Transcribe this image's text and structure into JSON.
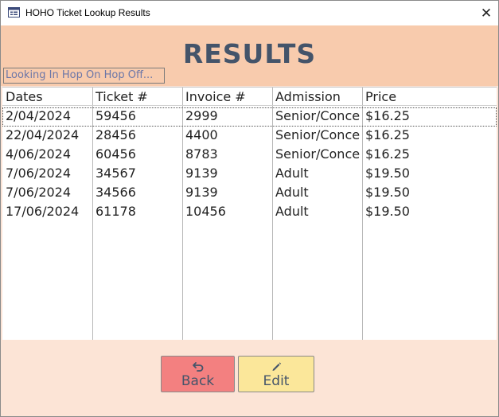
{
  "window": {
    "title": "HOHO Ticket Lookup Results",
    "close_glyph": "✕"
  },
  "heading": "RESULTS",
  "status": "Looking In Hop On Hop Off...",
  "table": {
    "columns": [
      "Dates",
      "Ticket #",
      "Invoice #",
      "Admission",
      "Price"
    ],
    "rows": [
      [
        "2/04/2024",
        "59456",
        "2999",
        "Senior/Concession",
        "$16.25"
      ],
      [
        "22/04/2024",
        "28456",
        "4400",
        "Senior/Concession",
        "$16.25"
      ],
      [
        "4/06/2024",
        "60456",
        "8783",
        "Senior/Concession",
        "$16.25"
      ],
      [
        "7/06/2024",
        "34567",
        "9139",
        "Adult",
        "$19.50"
      ],
      [
        "7/06/2024",
        "34566",
        "9139",
        "Adult",
        "$19.50"
      ],
      [
        "17/06/2024",
        "61178",
        "10456",
        "Adult",
        "$19.50"
      ]
    ]
  },
  "buttons": {
    "back": {
      "label": "Back",
      "icon": "undo-arrow-icon"
    },
    "edit": {
      "label": "Edit",
      "icon": "pencil-icon"
    }
  },
  "colors": {
    "header_band": "#f8cbad",
    "background": "#fce4d6",
    "heading_text": "#44546a",
    "back_button": "#f38080",
    "edit_button": "#fbe79a"
  }
}
